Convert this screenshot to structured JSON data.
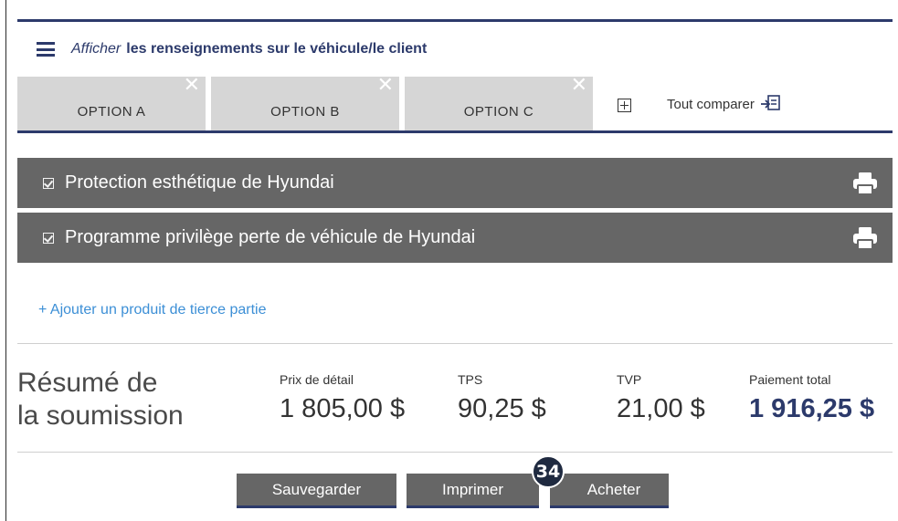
{
  "header": {
    "info_prefix": "Afficher",
    "info_text": "les renseignements sur le véhicule/le client"
  },
  "tabs": [
    {
      "label": "OPTION  A",
      "close": "✕"
    },
    {
      "label": "OPTION  B",
      "close": "✕"
    },
    {
      "label": "OPTION  C",
      "close": "✕"
    }
  ],
  "compare_all_label": "Tout comparer",
  "products": [
    {
      "label": "Protection esthétique de Hyundai"
    },
    {
      "label": "Programme privilège perte de véhicule de Hyundai"
    }
  ],
  "add_third_party": "+ Ajouter un produit de tierce partie",
  "summary": {
    "title_line1": "Résumé de",
    "title_line2": "la soumission",
    "retail_label": "Prix de détail",
    "retail_value": "1 805,00 $",
    "gst_label": "TPS",
    "gst_value": "90,25 $",
    "pst_label": "TVP",
    "pst_value": "21,00 $",
    "total_label": "Paiement total",
    "total_value": "1 916,25 $"
  },
  "actions": {
    "save": "Sauvegarder",
    "print": "Imprimer",
    "buy": "Acheter"
  },
  "step_badge": "34",
  "colors": {
    "accent_navy": "#2c3a6b",
    "bar_gray": "#666666",
    "tab_gray": "#d6d6d6",
    "link_blue": "#3c8fd6"
  }
}
